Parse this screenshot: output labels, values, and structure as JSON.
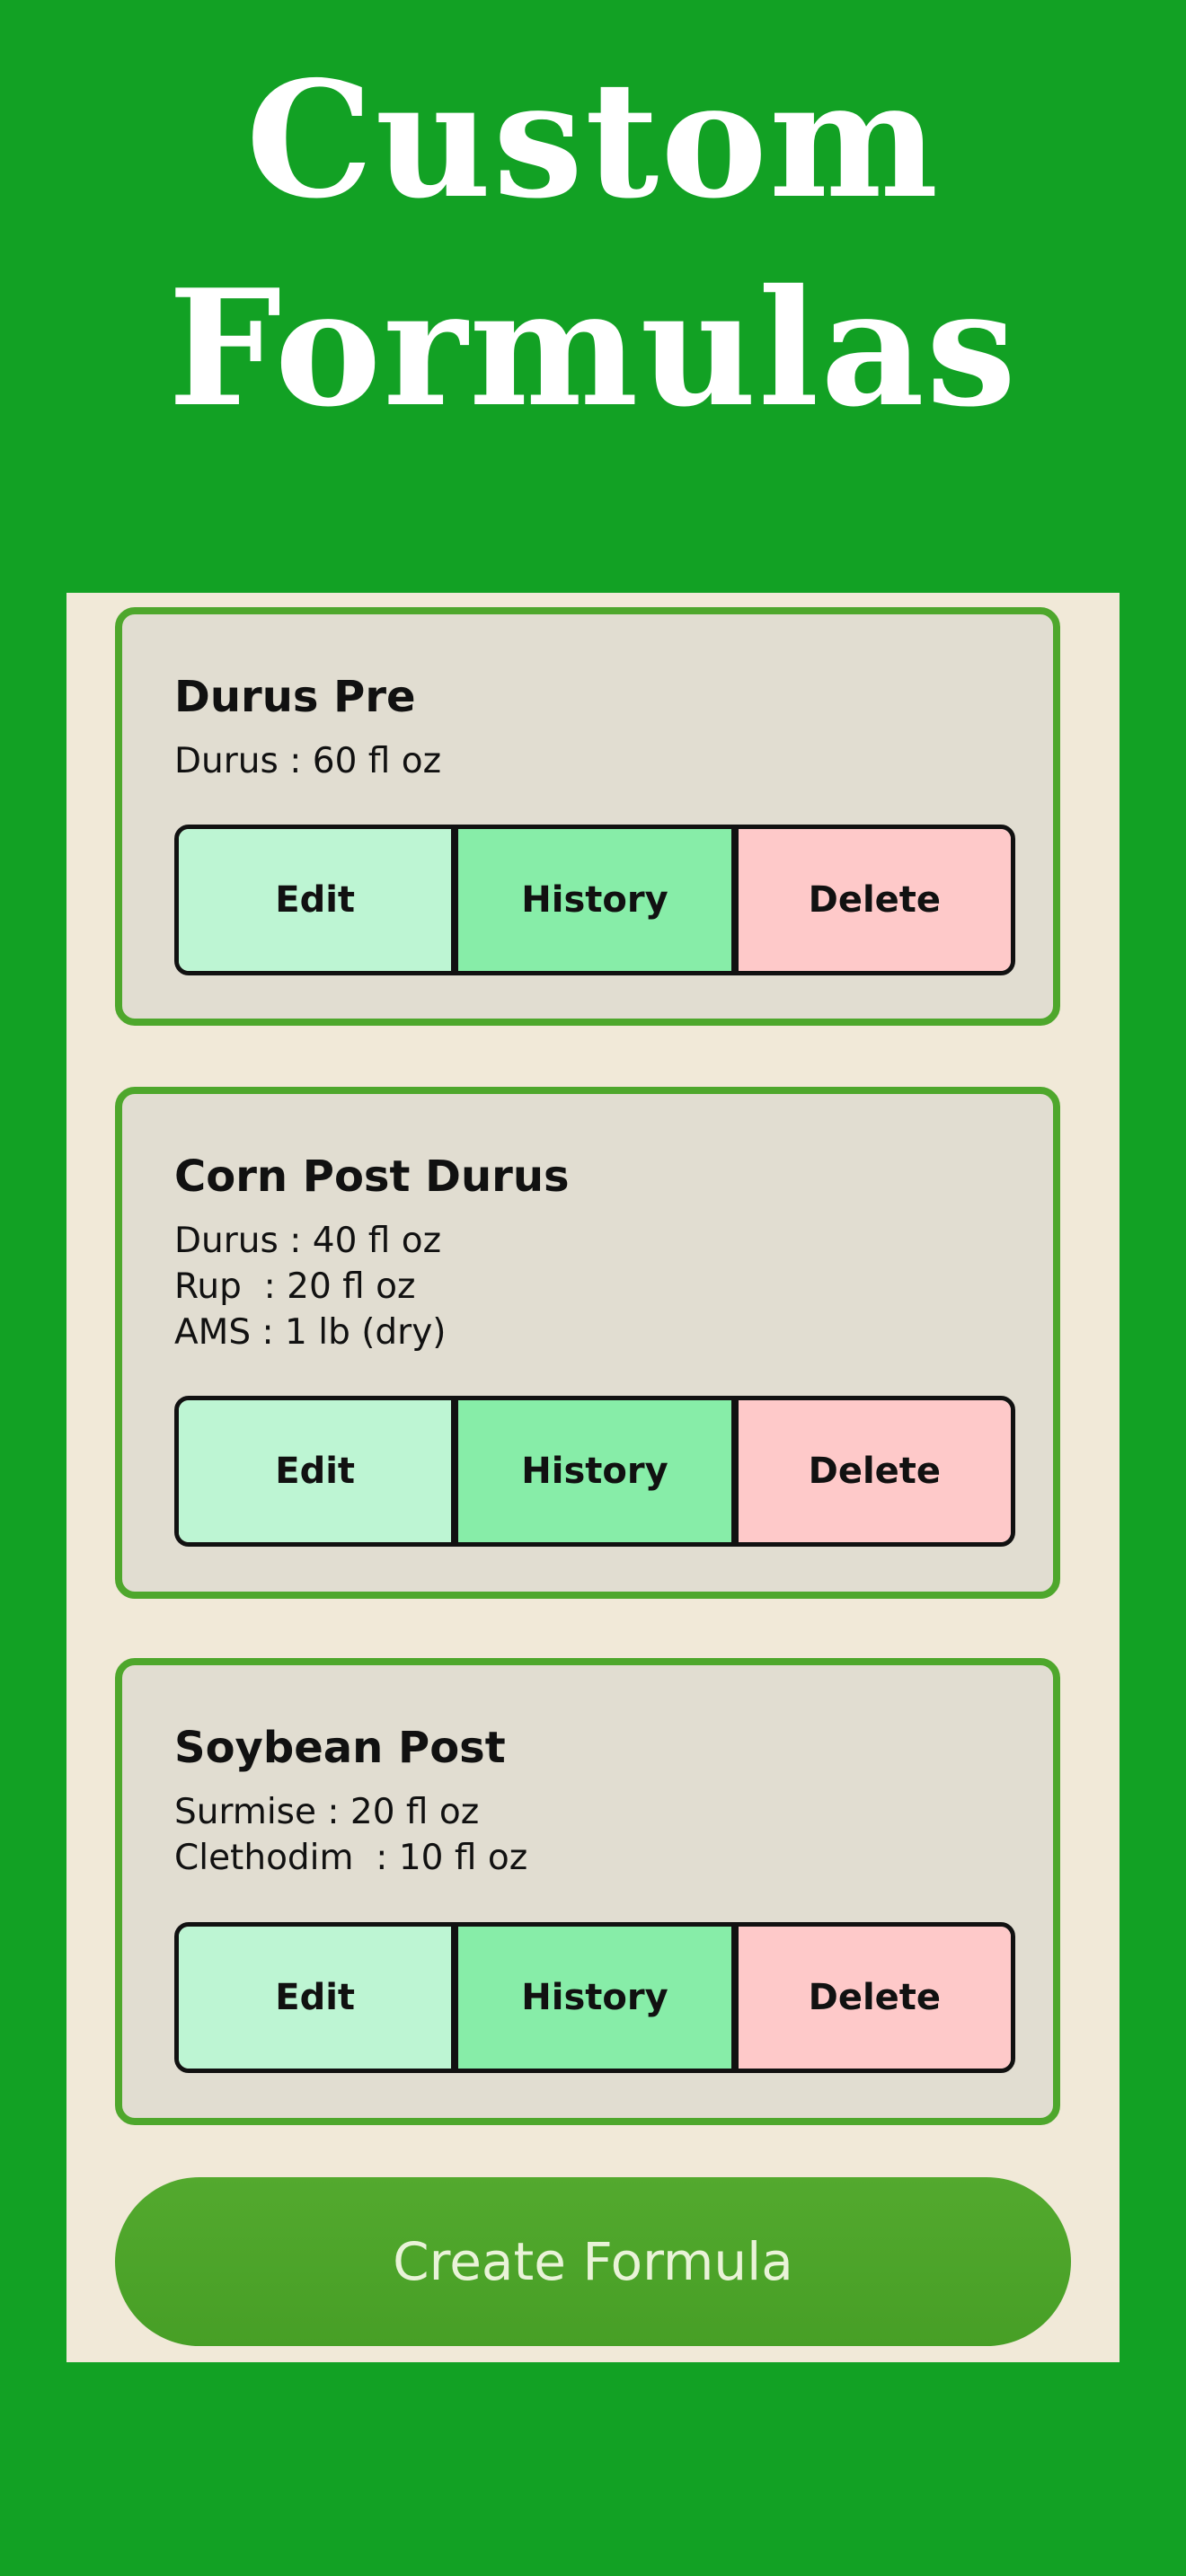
{
  "header": {
    "title_line1": "Custom",
    "title_line2": "Formulas"
  },
  "formulas": [
    {
      "name": "Durus Pre",
      "ingredients": "Durus : 60 fl oz"
    },
    {
      "name": "Corn Post Durus",
      "ingredients": "Durus : 40 fl oz\nRup  : 20 fl oz\nAMS : 1 lb (dry)"
    },
    {
      "name": "Soybean Post",
      "ingredients": "Surmise : 20 fl oz\nClethodim  : 10 fl oz"
    }
  ],
  "buttons": {
    "edit": "Edit",
    "history": "History",
    "delete": "Delete"
  },
  "create_button": "Create Formula",
  "colors": {
    "background": "#12a124",
    "panel": "#f1e9d8",
    "card": "#e1ddd1",
    "card_border": "#4ea72c",
    "edit": "#bdf5d3",
    "history": "#87eda8",
    "delete": "#fec9c9",
    "create": "#4ea72c"
  }
}
